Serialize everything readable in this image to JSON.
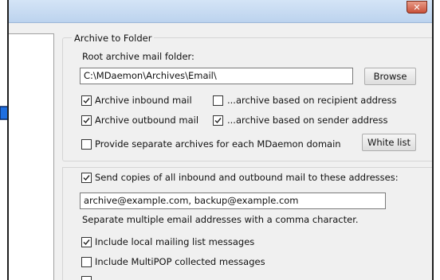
{
  "window": {
    "close_label": "✕"
  },
  "archive_group": {
    "title": "Archive to Folder",
    "root_label": "Root archive mail folder:",
    "root_value": "C:\\MDaemon\\Archives\\Email\\",
    "browse_label": "Browse",
    "inbound_label": "Archive inbound mail",
    "inbound_checked": true,
    "recipient_label": "...archive based on recipient address",
    "recipient_checked": false,
    "outbound_label": "Archive outbound mail",
    "outbound_checked": true,
    "sender_label": "...archive based on sender address",
    "sender_checked": true,
    "separate_label": "Provide separate archives for each MDaemon domain",
    "separate_checked": false,
    "whitelist_label": "White list"
  },
  "copies_group": {
    "send_label": "Send copies of all inbound and outbound mail to these addresses:",
    "send_checked": true,
    "addresses_value": "archive@example.com, backup@example.com",
    "hint": "Separate multiple email addresses with a comma character.",
    "local_label": "Include local mailing list messages",
    "local_checked": true,
    "multipop_label": "Include MultiPOP collected messages",
    "multipop_checked": false
  },
  "colors": {
    "arrow": "#1f6fe0",
    "arrow_outline": "#0a2a66"
  }
}
